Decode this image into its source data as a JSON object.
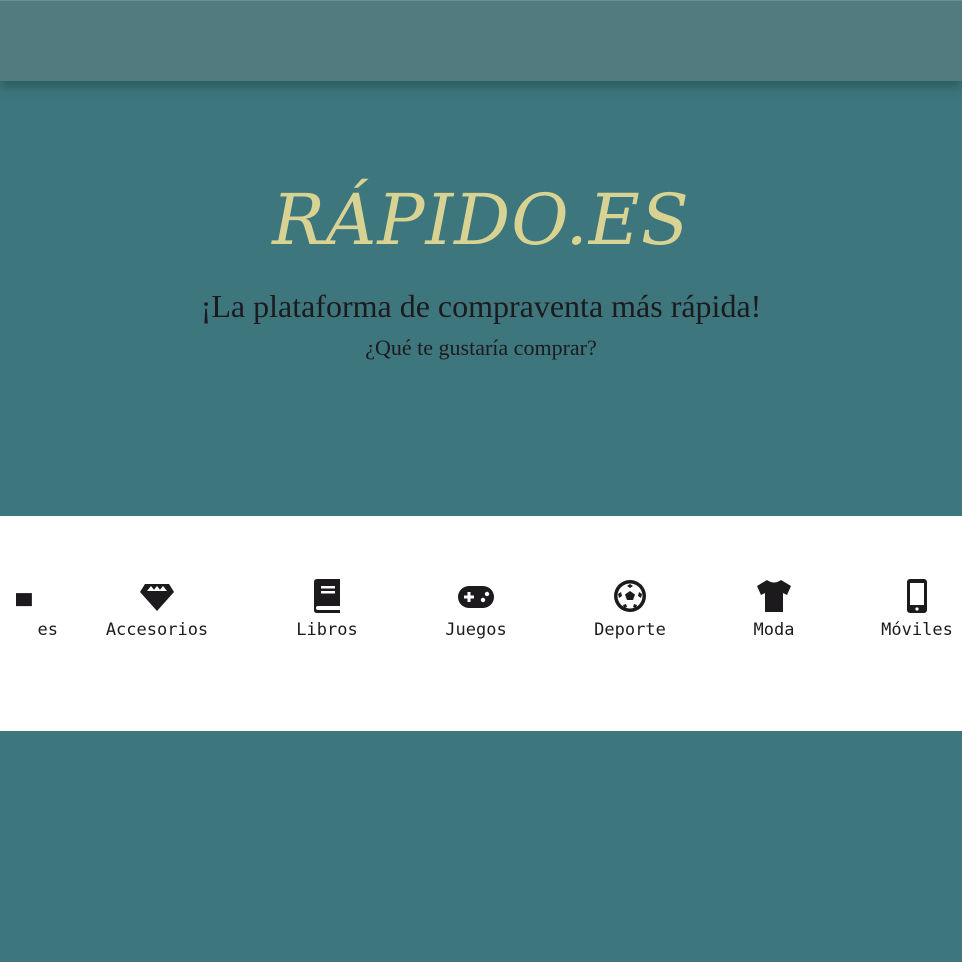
{
  "header": {
    "brand": "RÁPIDO.ES",
    "tagline": "¡La plataforma de compraventa más rápida!",
    "question": "¿Qué te gustaría comprar?"
  },
  "categories": [
    {
      "label": "es",
      "icon": "home-icon"
    },
    {
      "label": "Accesorios",
      "icon": "diamond-icon"
    },
    {
      "label": "Libros",
      "icon": "book-icon"
    },
    {
      "label": "Juegos",
      "icon": "gamepad-icon"
    },
    {
      "label": "Deporte",
      "icon": "soccer-ball-icon"
    },
    {
      "label": "Moda",
      "icon": "tshirt-icon"
    },
    {
      "label": "Móviles",
      "icon": "mobile-phone-icon"
    }
  ],
  "colors": {
    "background": "#3d777d",
    "topbar": "#527b80",
    "brand": "#d9d393",
    "text": "#1d1a1e",
    "category_band": "#ffffff"
  }
}
